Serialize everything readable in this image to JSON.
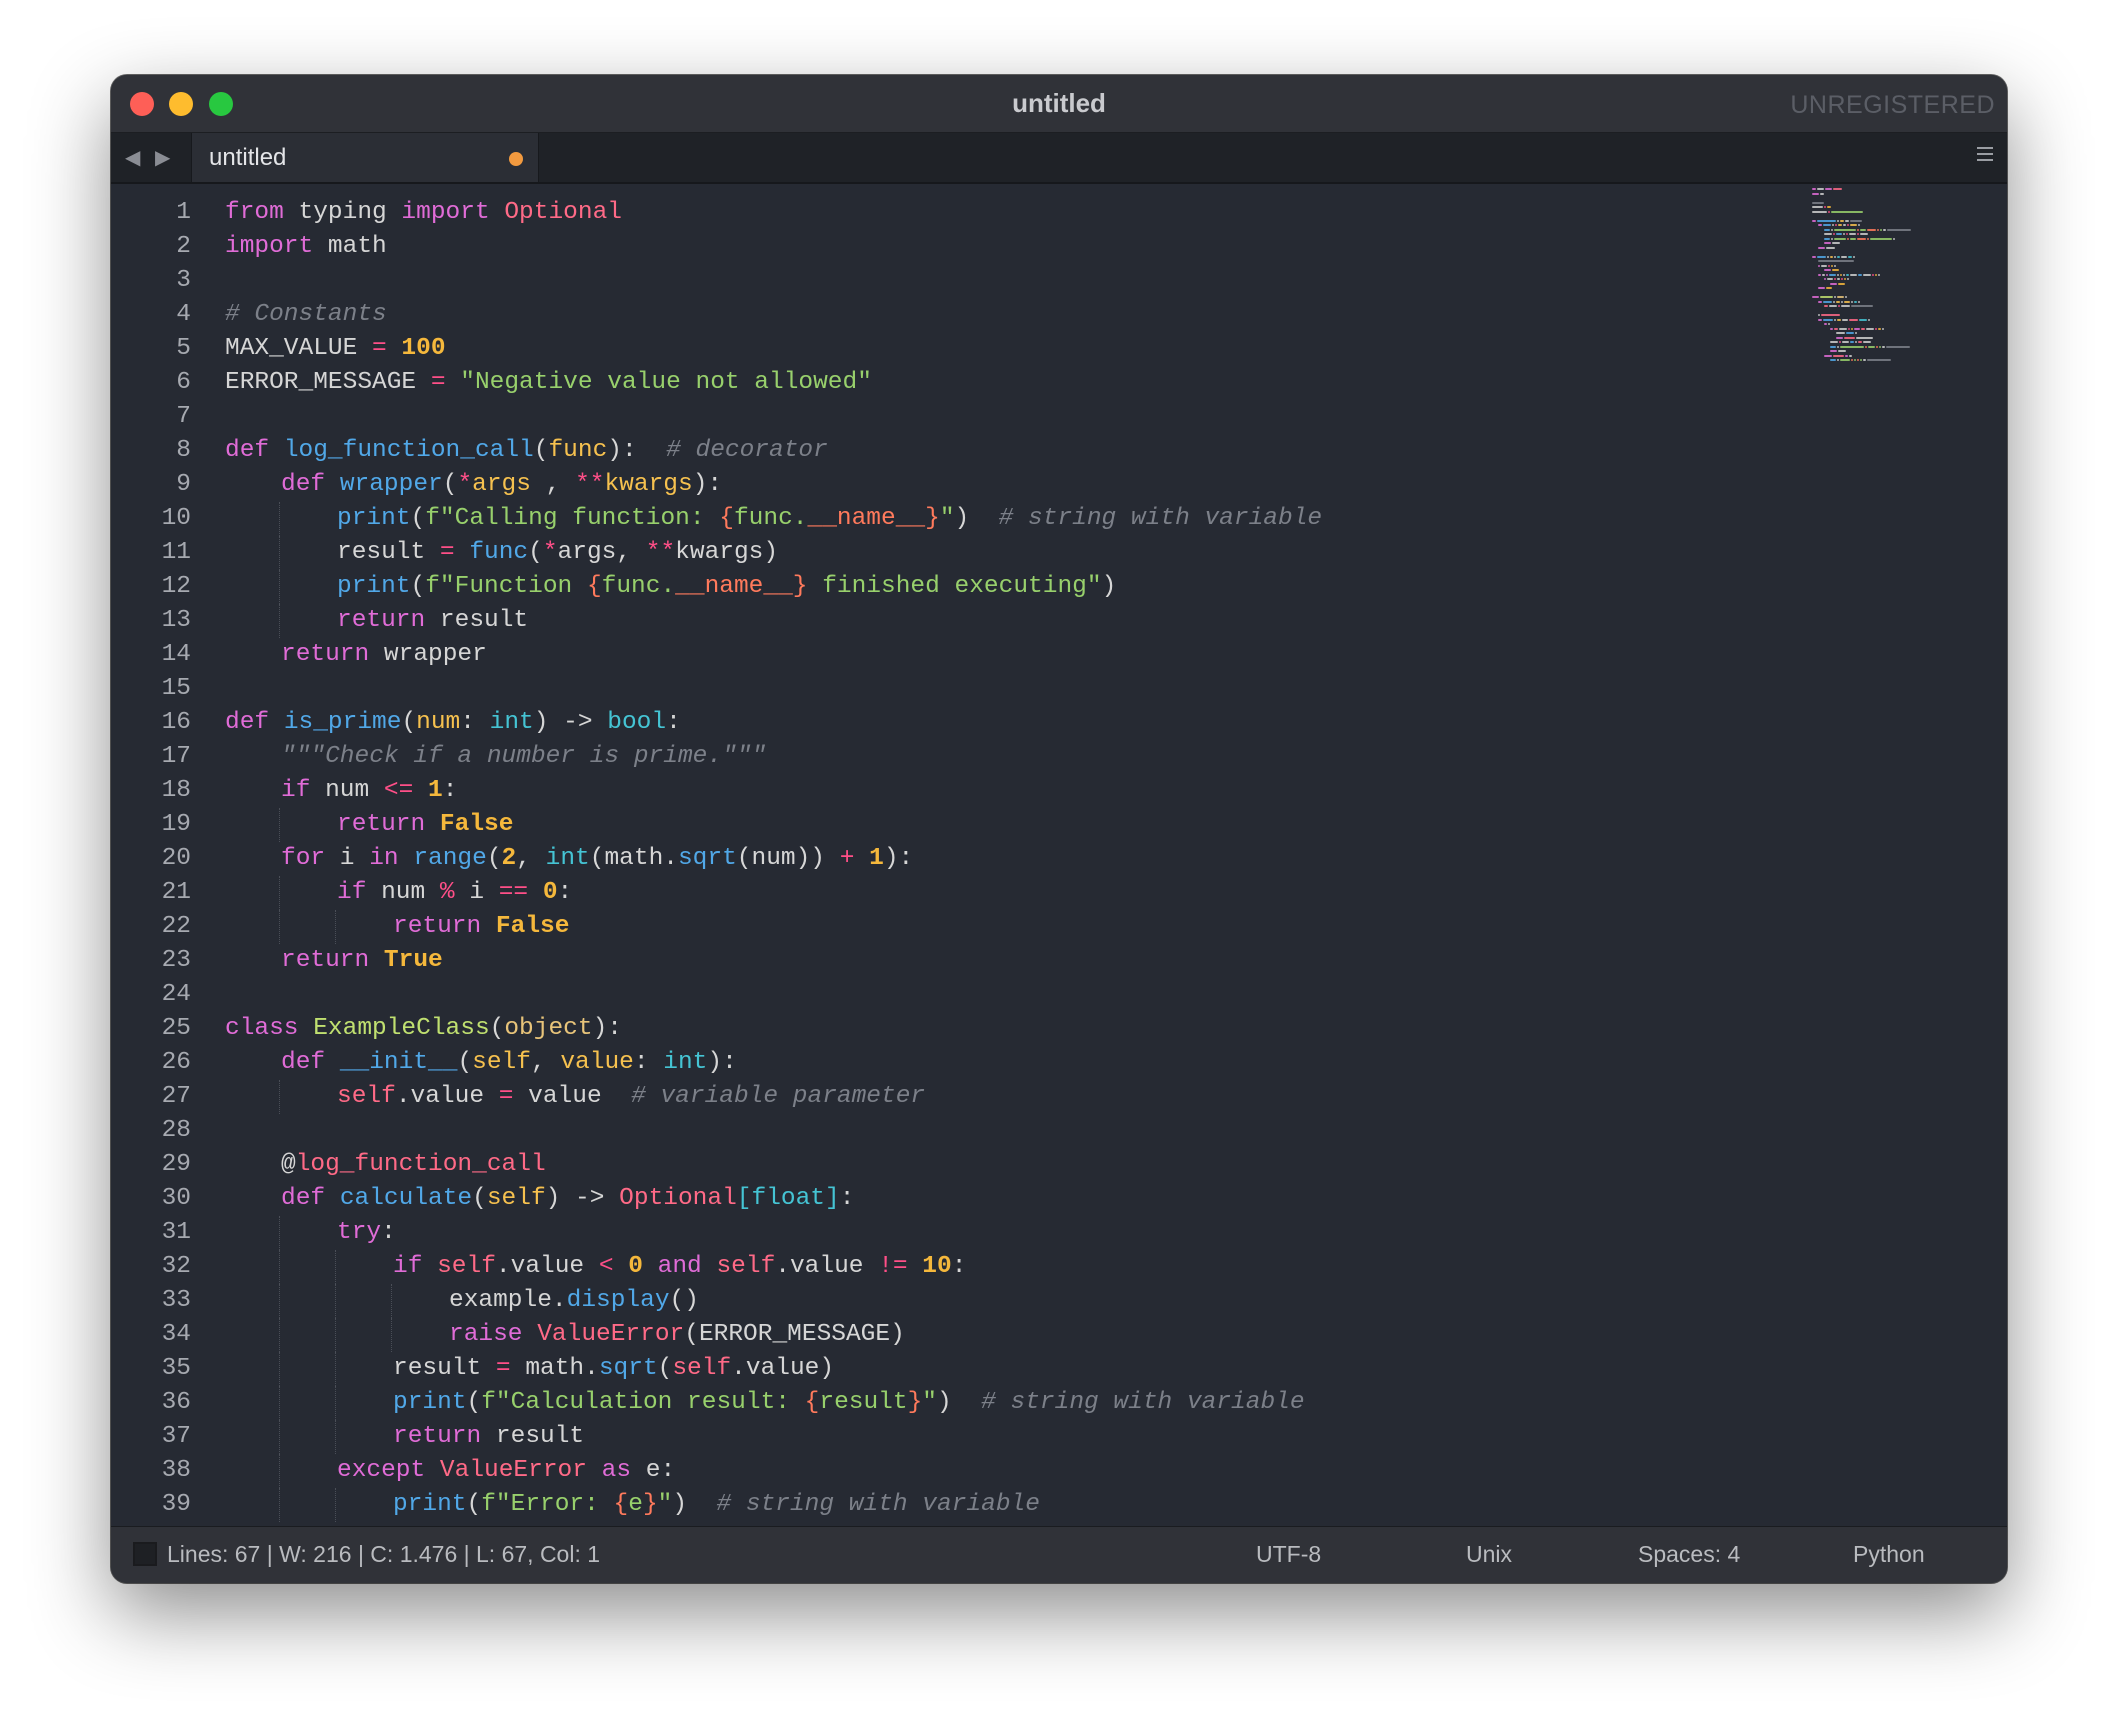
{
  "window": {
    "title": "untitled",
    "unregistered": "UNREGISTERED"
  },
  "tabbar": {
    "tab_label": "untitled",
    "nav_back": "◀",
    "nav_forward": "▶"
  },
  "colors": {
    "modified_dot": "#f29a3f",
    "close": "#fe5f57",
    "minimize": "#febc2e",
    "maximize": "#28c840"
  },
  "editor": {
    "language": "Python",
    "lines": [
      {
        "n": "1",
        "indent": 0,
        "tokens": [
          [
            "kw",
            "from"
          ],
          [
            "",
            "typing"
          ],
          [
            "kw",
            "import"
          ],
          [
            "ip",
            "Optional"
          ]
        ],
        "sep": " "
      },
      {
        "n": "2",
        "indent": 0,
        "tokens": [
          [
            "kw",
            "import"
          ],
          [
            "",
            "math"
          ]
        ],
        "sep": " "
      },
      {
        "n": "3",
        "indent": 0,
        "tokens": []
      },
      {
        "n": "4",
        "indent": 0,
        "tokens": [
          [
            "cm",
            "# Constants"
          ]
        ]
      },
      {
        "n": "5",
        "indent": 0,
        "tokens": [
          [
            "",
            "MAX_VALUE "
          ],
          [
            "op",
            "="
          ],
          [
            "nm",
            " 100"
          ]
        ]
      },
      {
        "n": "6",
        "indent": 0,
        "tokens": [
          [
            "",
            "ERROR_MESSAGE "
          ],
          [
            "op",
            "="
          ],
          [
            "st",
            " \"Negative value not allowed\""
          ]
        ]
      },
      {
        "n": "7",
        "indent": 0,
        "tokens": []
      },
      {
        "n": "8",
        "indent": 0,
        "tokens": [
          [
            "kw",
            "def "
          ],
          [
            "fn",
            "log_function_call"
          ],
          [
            "",
            "("
          ],
          [
            "pm",
            "func"
          ],
          [
            "",
            "):  "
          ],
          [
            "cm",
            "# decorator"
          ]
        ]
      },
      {
        "n": "9",
        "indent": 1,
        "tokens": [
          [
            "kw",
            "def "
          ],
          [
            "fn",
            "wrapper"
          ],
          [
            "",
            "("
          ],
          [
            "op",
            "*"
          ],
          [
            "pm",
            "args"
          ],
          [
            "",
            " , "
          ],
          [
            "op",
            "**"
          ],
          [
            "pm",
            "kwargs"
          ],
          [
            "",
            "):"
          ]
        ]
      },
      {
        "n": "10",
        "indent": 2,
        "tokens": [
          [
            "fn",
            "print"
          ],
          [
            "",
            "("
          ],
          [
            "st",
            "f\"Calling function: "
          ],
          [
            "iv",
            "{"
          ],
          [
            "st",
            "func."
          ],
          [
            "iv",
            "__name__"
          ],
          [
            "iv",
            "}"
          ],
          [
            "st",
            "\""
          ],
          [
            "",
            ")  "
          ],
          [
            "cm",
            "# string with variable"
          ]
        ]
      },
      {
        "n": "11",
        "indent": 2,
        "tokens": [
          [
            "",
            "result "
          ],
          [
            "op",
            "="
          ],
          [
            "fn",
            " func"
          ],
          [
            "",
            "("
          ],
          [
            "op",
            "*"
          ],
          [
            "",
            "args, "
          ],
          [
            "op",
            "**"
          ],
          [
            "",
            "kwargs)"
          ]
        ]
      },
      {
        "n": "12",
        "indent": 2,
        "tokens": [
          [
            "fn",
            "print"
          ],
          [
            "",
            "("
          ],
          [
            "st",
            "f\"Function "
          ],
          [
            "iv",
            "{"
          ],
          [
            "st",
            "func."
          ],
          [
            "iv",
            "__name__"
          ],
          [
            "iv",
            "}"
          ],
          [
            "st",
            " finished executing\""
          ],
          [
            "",
            ")"
          ]
        ]
      },
      {
        "n": "13",
        "indent": 2,
        "tokens": [
          [
            "kw",
            "return"
          ],
          [
            "",
            " result"
          ]
        ]
      },
      {
        "n": "14",
        "indent": 1,
        "tokens": [
          [
            "kw",
            "return"
          ],
          [
            "",
            " wrapper"
          ]
        ]
      },
      {
        "n": "15",
        "indent": 0,
        "tokens": []
      },
      {
        "n": "16",
        "indent": 0,
        "tokens": [
          [
            "kw",
            "def "
          ],
          [
            "fn",
            "is_prime"
          ],
          [
            "",
            "("
          ],
          [
            "pm",
            "num"
          ],
          [
            "",
            ": "
          ],
          [
            "ty",
            "int"
          ],
          [
            "",
            ") -> "
          ],
          [
            "ty",
            "bool"
          ],
          [
            "",
            ":"
          ]
        ]
      },
      {
        "n": "17",
        "indent": 1,
        "tokens": [
          [
            "cm",
            "\"\"\"Check if a number is prime.\"\"\""
          ]
        ]
      },
      {
        "n": "18",
        "indent": 1,
        "tokens": [
          [
            "kw",
            "if"
          ],
          [
            "",
            " num "
          ],
          [
            "op",
            "<="
          ],
          [
            "nm",
            " 1"
          ],
          [
            "",
            ":"
          ]
        ]
      },
      {
        "n": "19",
        "indent": 2,
        "tokens": [
          [
            "kw",
            "return"
          ],
          [
            "nm",
            " False"
          ]
        ]
      },
      {
        "n": "20",
        "indent": 1,
        "tokens": [
          [
            "kw",
            "for"
          ],
          [
            "",
            " i "
          ],
          [
            "kw",
            "in"
          ],
          [
            "fn",
            " range"
          ],
          [
            "",
            "("
          ],
          [
            "nm",
            "2"
          ],
          [
            "",
            ", "
          ],
          [
            "ty",
            "int"
          ],
          [
            "",
            "(math."
          ],
          [
            "fn",
            "sqrt"
          ],
          [
            "",
            "(num)) "
          ],
          [
            "op",
            "+"
          ],
          [
            "nm",
            " 1"
          ],
          [
            "",
            "):"
          ]
        ]
      },
      {
        "n": "21",
        "indent": 2,
        "tokens": [
          [
            "kw",
            "if"
          ],
          [
            "",
            " num "
          ],
          [
            "op",
            "%"
          ],
          [
            "",
            " i "
          ],
          [
            "op",
            "=="
          ],
          [
            "nm",
            " 0"
          ],
          [
            "",
            ":"
          ]
        ]
      },
      {
        "n": "22",
        "indent": 3,
        "tokens": [
          [
            "kw",
            "return"
          ],
          [
            "nm",
            " False"
          ]
        ]
      },
      {
        "n": "23",
        "indent": 1,
        "tokens": [
          [
            "kw",
            "return"
          ],
          [
            "nm",
            " True"
          ]
        ]
      },
      {
        "n": "24",
        "indent": 0,
        "tokens": []
      },
      {
        "n": "25",
        "indent": 0,
        "tokens": [
          [
            "kw",
            "class "
          ],
          [
            "cl",
            "ExampleClass"
          ],
          [
            "",
            "("
          ],
          [
            "br",
            "object"
          ],
          [
            "",
            "):"
          ]
        ]
      },
      {
        "n": "26",
        "indent": 1,
        "tokens": [
          [
            "kw",
            "def "
          ],
          [
            "fn",
            "__init__"
          ],
          [
            "",
            "("
          ],
          [
            "pm",
            "self"
          ],
          [
            "",
            ", "
          ],
          [
            "pm",
            "value"
          ],
          [
            "",
            ": "
          ],
          [
            "ty",
            "int"
          ],
          [
            "",
            "):"
          ]
        ]
      },
      {
        "n": "27",
        "indent": 2,
        "tokens": [
          [
            "sf",
            "self"
          ],
          [
            "",
            ".value "
          ],
          [
            "op",
            "="
          ],
          [
            "",
            " value  "
          ],
          [
            "cm",
            "# variable parameter"
          ]
        ]
      },
      {
        "n": "28",
        "indent": 0,
        "tokens": []
      },
      {
        "n": "29",
        "indent": 1,
        "tokens": [
          [
            "",
            "@"
          ],
          [
            "ip",
            "log_function_call"
          ]
        ]
      },
      {
        "n": "30",
        "indent": 1,
        "tokens": [
          [
            "kw",
            "def "
          ],
          [
            "fn",
            "calculate"
          ],
          [
            "",
            "("
          ],
          [
            "pm",
            "self"
          ],
          [
            "",
            ") -> "
          ],
          [
            "ip",
            "Optional"
          ],
          [
            "ty",
            "[float]"
          ],
          [
            "",
            ":"
          ]
        ]
      },
      {
        "n": "31",
        "indent": 2,
        "tokens": [
          [
            "kw",
            "try"
          ],
          [
            "",
            ":"
          ]
        ]
      },
      {
        "n": "32",
        "indent": 3,
        "tokens": [
          [
            "kw",
            "if "
          ],
          [
            "sf",
            "self"
          ],
          [
            "",
            ".value "
          ],
          [
            "op",
            "<"
          ],
          [
            "nm",
            " 0"
          ],
          [
            "kw",
            " and "
          ],
          [
            "sf",
            "self"
          ],
          [
            "",
            ".value "
          ],
          [
            "op",
            "!="
          ],
          [
            "nm",
            " 10"
          ],
          [
            "",
            ":"
          ]
        ]
      },
      {
        "n": "33",
        "indent": 4,
        "tokens": [
          [
            "",
            "example."
          ],
          [
            "fn",
            "display"
          ],
          [
            "",
            "()"
          ]
        ]
      },
      {
        "n": "34",
        "indent": 4,
        "tokens": [
          [
            "kw",
            "raise "
          ],
          [
            "ip",
            "ValueError"
          ],
          [
            "",
            "(ERROR_MESSAGE)"
          ]
        ]
      },
      {
        "n": "35",
        "indent": 3,
        "tokens": [
          [
            "",
            "result "
          ],
          [
            "op",
            "="
          ],
          [
            "",
            " math."
          ],
          [
            "fn",
            "sqrt"
          ],
          [
            "",
            "("
          ],
          [
            "sf",
            "self"
          ],
          [
            "",
            ".value)"
          ]
        ]
      },
      {
        "n": "36",
        "indent": 3,
        "tokens": [
          [
            "fn",
            "print"
          ],
          [
            "",
            "("
          ],
          [
            "st",
            "f\"Calculation result: "
          ],
          [
            "iv",
            "{"
          ],
          [
            "st",
            "result"
          ],
          [
            "iv",
            "}"
          ],
          [
            "st",
            "\""
          ],
          [
            "",
            ")  "
          ],
          [
            "cm",
            "# string with variable"
          ]
        ]
      },
      {
        "n": "37",
        "indent": 3,
        "tokens": [
          [
            "kw",
            "return"
          ],
          [
            "",
            " result"
          ]
        ]
      },
      {
        "n": "38",
        "indent": 2,
        "tokens": [
          [
            "kw",
            "except "
          ],
          [
            "ip",
            "ValueError"
          ],
          [
            "kw",
            " as"
          ],
          [
            "",
            " e:"
          ]
        ]
      },
      {
        "n": "39",
        "indent": 3,
        "tokens": [
          [
            "fn",
            "print"
          ],
          [
            "",
            "("
          ],
          [
            "st",
            "f\"Error: "
          ],
          [
            "iv",
            "{"
          ],
          [
            "st",
            "e"
          ],
          [
            "iv",
            "}"
          ],
          [
            "st",
            "\""
          ],
          [
            "",
            ")  "
          ],
          [
            "cm",
            "# string with variable"
          ]
        ]
      }
    ]
  },
  "status": {
    "info": "Lines: 67 | W: 216 | C: 1.476 | L: 67, Col: 1",
    "encoding": "UTF-8",
    "line_endings": "Unix",
    "indentation": "Spaces: 4",
    "syntax": "Python"
  }
}
